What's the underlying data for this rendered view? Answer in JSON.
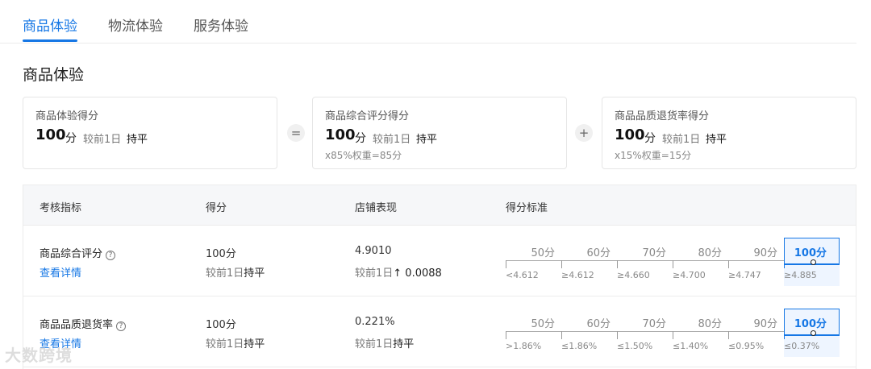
{
  "tabs": [
    "商品体验",
    "物流体验",
    "服务体验"
  ],
  "section_title": "商品体验",
  "cards": [
    {
      "label": "商品体验得分",
      "score": "100",
      "unit": "分",
      "compare": "较前1日",
      "trend": "持平",
      "weight": ""
    },
    {
      "label": "商品综合评分得分",
      "score": "100",
      "unit": "分",
      "compare": "较前1日",
      "trend": "持平",
      "weight": "x85%权重=85分"
    },
    {
      "label": "商品品质退货率得分",
      "score": "100",
      "unit": "分",
      "compare": "较前1日",
      "trend": "持平",
      "weight": "x15%权重=15分"
    }
  ],
  "operators": [
    "=",
    "+"
  ],
  "table": {
    "headers": [
      "考核指标",
      "得分",
      "店铺表现",
      "得分标准"
    ],
    "rows": [
      {
        "metric": "商品综合评分",
        "detail_link": "查看详情",
        "score": "100分",
        "score_compare": "较前1日",
        "score_trend": "持平",
        "performance": "4.9010",
        "perf_compare": "较前1日",
        "perf_trend": "↑ 0.0088",
        "standard_scores": [
          "50分",
          "60分",
          "70分",
          "80分",
          "90分",
          "100分"
        ],
        "standard_thresholds": [
          "<4.612",
          "≥4.612",
          "≥4.660",
          "≥4.700",
          "≥4.747",
          "≥4.885"
        ]
      },
      {
        "metric": "商品品质退货率",
        "detail_link": "查看详情",
        "score": "100分",
        "score_compare": "较前1日",
        "score_trend": "持平",
        "performance": "0.221%",
        "perf_compare": "较前1日",
        "perf_trend": "持平",
        "standard_scores": [
          "50分",
          "60分",
          "70分",
          "80分",
          "90分",
          "100分"
        ],
        "standard_thresholds": [
          ">1.86%",
          "≤1.86%",
          "≤1.50%",
          "≤1.40%",
          "≤0.95%",
          "≤0.37%"
        ]
      }
    ]
  },
  "watermark": "大数跨境",
  "colors": {
    "accent": "#1677e5",
    "header_bg": "#f6f7f9",
    "highlight_bg": "#eef5ff"
  }
}
